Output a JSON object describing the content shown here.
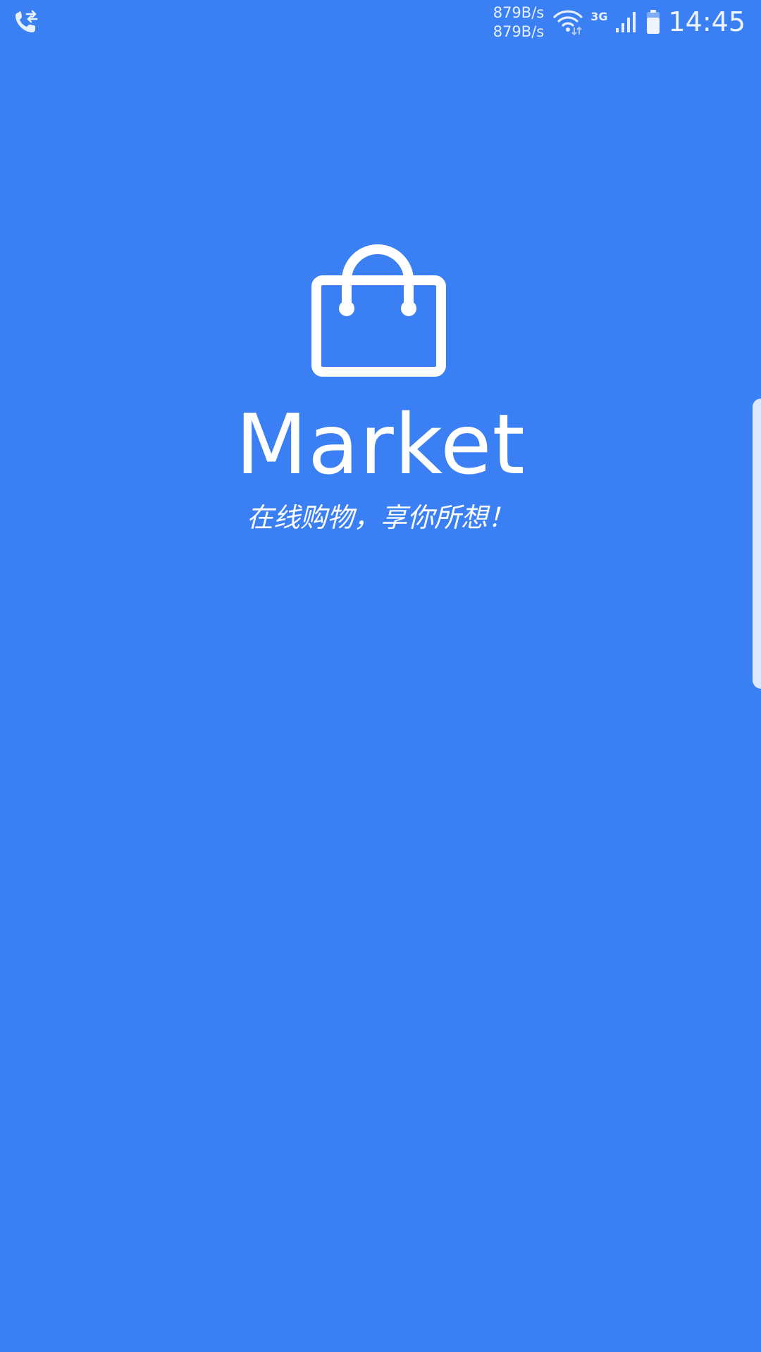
{
  "status_bar": {
    "left_icon": "call-forward-icon",
    "net_speed_up": "879B/s",
    "net_speed_down": "879B/s",
    "wifi_icon": "wifi-icon",
    "network_type": "3G",
    "signal_icon": "signal-icon",
    "battery_icon": "battery-icon",
    "time": "14:45"
  },
  "splash": {
    "logo_icon": "shopping-bag-icon",
    "title": "Market",
    "slogan": "在线购物，享你所想！"
  },
  "edge_panel": {
    "handle_icon": "edge-panel-handle"
  },
  "colors": {
    "background": "#3a80f4",
    "foreground": "#ffffff"
  }
}
